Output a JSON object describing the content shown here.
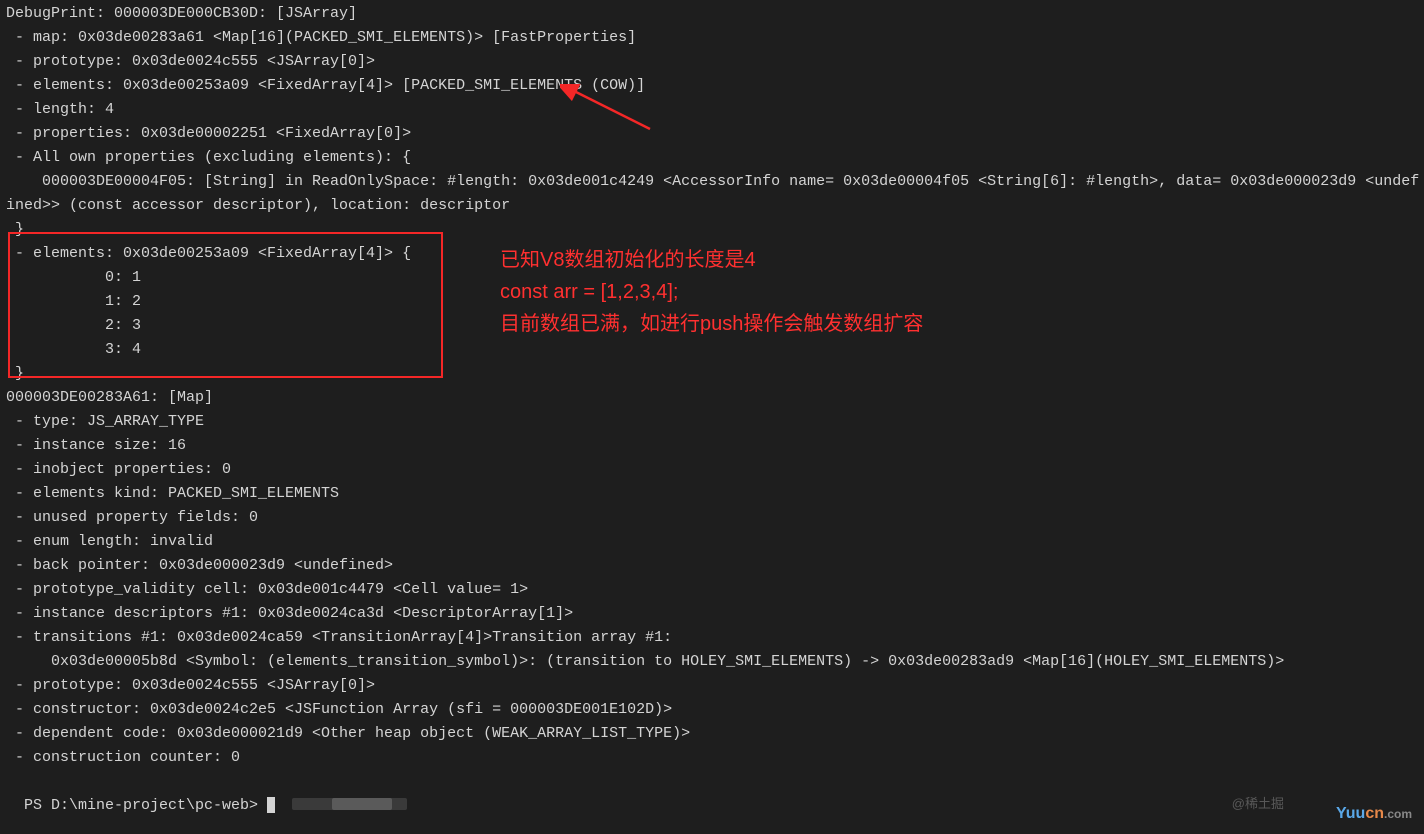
{
  "terminal": {
    "lines": [
      "DebugPrint: 000003DE000CB30D: [JSArray]",
      " - map: 0x03de00283a61 <Map[16](PACKED_SMI_ELEMENTS)> [FastProperties]",
      " - prototype: 0x03de0024c555 <JSArray[0]>",
      " - elements: 0x03de00253a09 <FixedArray[4]> [PACKED_SMI_ELEMENTS (COW)]",
      " - length: 4",
      " - properties: 0x03de00002251 <FixedArray[0]>",
      " - All own properties (excluding elements): {",
      "    000003DE00004F05: [String] in ReadOnlySpace: #length: 0x03de001c4249 <AccessorInfo name= 0x03de00004f05 <String[6]: #length>, data= 0x03de000023d9 <undef",
      "ined>> (const accessor descriptor), location: descriptor",
      " }",
      " - elements: 0x03de00253a09 <FixedArray[4]> {",
      "           0: 1",
      "           1: 2",
      "           2: 3",
      "           3: 4",
      " }",
      "000003DE00283A61: [Map]",
      " - type: JS_ARRAY_TYPE",
      " - instance size: 16",
      " - inobject properties: 0",
      " - elements kind: PACKED_SMI_ELEMENTS",
      " - unused property fields: 0",
      " - enum length: invalid",
      " - back pointer: 0x03de000023d9 <undefined>",
      " - prototype_validity cell: 0x03de001c4479 <Cell value= 1>",
      " - instance descriptors #1: 0x03de0024ca3d <DescriptorArray[1]>",
      " - transitions #1: 0x03de0024ca59 <TransitionArray[4]>Transition array #1:",
      "     0x03de00005b8d <Symbol: (elements_transition_symbol)>: (transition to HOLEY_SMI_ELEMENTS) -> 0x03de00283ad9 <Map[16](HOLEY_SMI_ELEMENTS)>",
      "",
      " - prototype: 0x03de0024c555 <JSArray[0]>",
      " - constructor: 0x03de0024c2e5 <JSFunction Array (sfi = 000003DE001E102D)>",
      " - dependent code: 0x03de000021d9 <Other heap object (WEAK_ARRAY_LIST_TYPE)>",
      " - construction counter: 0",
      ""
    ],
    "prompt": "PS D:\\mine-project\\pc-web> "
  },
  "annotation": {
    "line1": "已知V8数组初始化的长度是4",
    "line2": "const arr = [1,2,3,4];",
    "line3": "目前数组已满，如进行push操作会触发数组扩容"
  },
  "watermark": "@稀土掘",
  "logo": {
    "part1": "Yuu",
    "part2": "cn",
    "part3": ".com"
  }
}
